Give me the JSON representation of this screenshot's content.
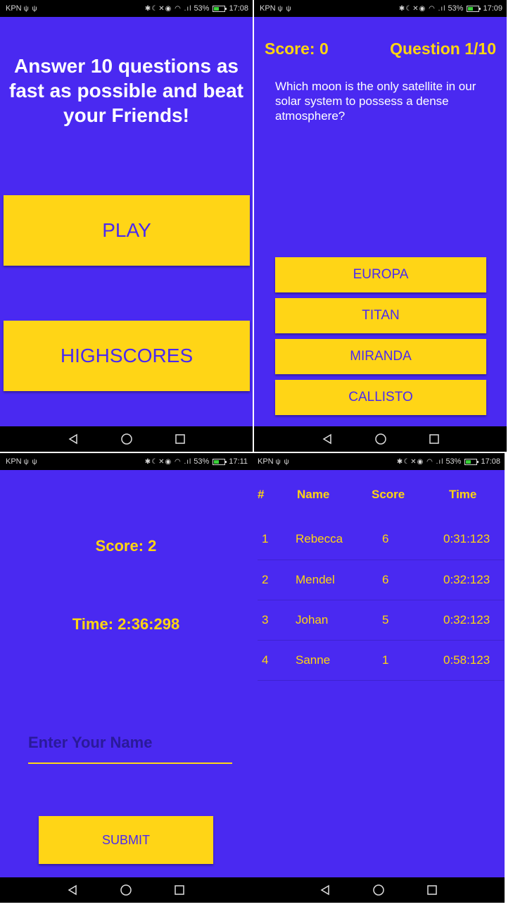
{
  "status": {
    "carrier": "KPN",
    "left_icons": "ψ ψ",
    "right_icons": "✱☾✕◉ ◠ .ıl",
    "battery": "53%",
    "battery_level": 0.53,
    "times": [
      "17:08",
      "17:09",
      "17:11",
      "17:08"
    ]
  },
  "home": {
    "intro": "Answer 10 questions as fast as possible and beat your Friends!",
    "play_label": "PLAY",
    "highscores_label": "HIGHSCORES"
  },
  "quiz": {
    "score": "Score: 0",
    "question_num": "Question 1/10",
    "question": "Which moon is the only satellite in our solar system to possess a dense atmosphere?",
    "answers": [
      "EUROPA",
      "TITAN",
      "MIRANDA",
      "CALLISTO"
    ]
  },
  "result": {
    "score": "Score: 2",
    "time": "Time: 2:36:298",
    "name_placeholder": "Enter Your Name",
    "submit_label": "SUBMIT"
  },
  "highscores": {
    "headers": [
      "#",
      "Name",
      "Score",
      "Time"
    ],
    "rows": [
      {
        "rank": "1",
        "name": "Rebecca",
        "score": "6",
        "time": "0:31:123"
      },
      {
        "rank": "2",
        "name": "Mendel",
        "score": "6",
        "time": "0:32:123"
      },
      {
        "rank": "3",
        "name": "Johan",
        "score": "5",
        "time": "0:32:123"
      },
      {
        "rank": "4",
        "name": "Sanne",
        "score": "1",
        "time": "0:58:123"
      }
    ]
  },
  "colors": {
    "background": "#4a29f1",
    "accent": "#ffd516",
    "bar": "#000000"
  },
  "icons": {
    "nav": [
      "back-icon",
      "home-icon",
      "recents-icon"
    ]
  }
}
